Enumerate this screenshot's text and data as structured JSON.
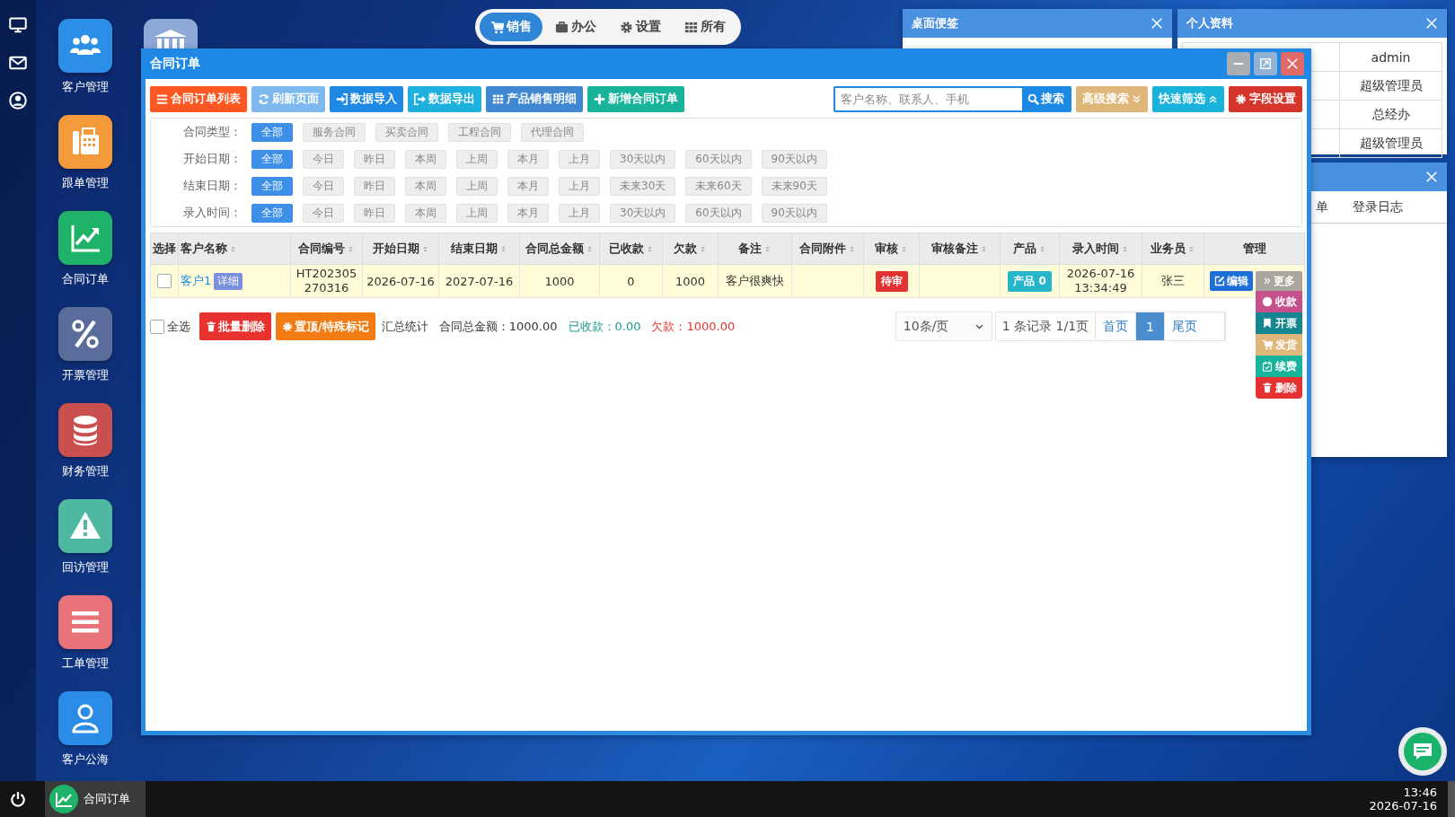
{
  "top_menu": [
    {
      "label": "销售",
      "selected": true
    },
    {
      "label": "办公",
      "selected": false
    },
    {
      "label": "设置",
      "selected": false
    },
    {
      "label": "所有",
      "selected": false
    }
  ],
  "desktop_icons": [
    {
      "label": "客户管理",
      "color": "#2b8fe8"
    },
    {
      "label": "跟单管理",
      "color": "#f39a3a"
    },
    {
      "label": "合同订单",
      "color": "#1fb36a"
    },
    {
      "label": "开票管理",
      "color": "#5a6d9a"
    },
    {
      "label": "财务管理",
      "color": "#c9504f"
    },
    {
      "label": "回访管理",
      "color": "#4fb8a0"
    },
    {
      "label": "工单管理",
      "color": "#e8737a"
    },
    {
      "label": "客户公海",
      "color": "#2a8ce6"
    }
  ],
  "partial_icon": {
    "color": "#8ea8d8"
  },
  "notes_window": {
    "title": "桌面便签"
  },
  "profile_window": {
    "title": "个人资料",
    "values": [
      "admin",
      "超级管理员",
      "总经办",
      "超级管理员"
    ]
  },
  "log_window": {
    "tabs": [
      "单",
      "登录日志"
    ]
  },
  "main_window": {
    "title": "合同订单",
    "toolbar": [
      {
        "label": "合同订单列表",
        "color": "#ff5722"
      },
      {
        "label": "刷新页面",
        "color": "#7db9ee"
      },
      {
        "label": "数据导入",
        "color": "#1e88e5"
      },
      {
        "label": "数据导出",
        "color": "#1eb1df"
      },
      {
        "label": "产品销售明细",
        "color": "#3f88d1"
      },
      {
        "label": "新增合同订单",
        "color": "#17b39a"
      }
    ],
    "search": {
      "placeholder": "客户名称、联系人、手机",
      "button": "搜索"
    },
    "search_tools": [
      {
        "label": "高级搜索",
        "color": "#e0b77b"
      },
      {
        "label": "快速筛选",
        "color": "#19b2da"
      },
      {
        "label": "字段设置",
        "color": "#d6352b"
      }
    ],
    "filters": [
      {
        "label": "合同类型：",
        "options": [
          {
            "label": "全部",
            "selected": true
          },
          {
            "label": "服务合同",
            "selected": false
          },
          {
            "label": "买卖合同",
            "selected": false
          },
          {
            "label": "工程合同",
            "selected": false
          },
          {
            "label": "代理合同",
            "selected": false
          }
        ]
      },
      {
        "label": "开始日期：",
        "options": [
          {
            "label": "全部",
            "selected": true
          },
          {
            "label": "今日",
            "selected": false
          },
          {
            "label": "昨日",
            "selected": false
          },
          {
            "label": "本周",
            "selected": false
          },
          {
            "label": "上周",
            "selected": false
          },
          {
            "label": "本月",
            "selected": false
          },
          {
            "label": "上月",
            "selected": false
          },
          {
            "label": "30天以内",
            "selected": false
          },
          {
            "label": "60天以内",
            "selected": false
          },
          {
            "label": "90天以内",
            "selected": false
          }
        ]
      },
      {
        "label": "结束日期：",
        "options": [
          {
            "label": "全部",
            "selected": true
          },
          {
            "label": "今日",
            "selected": false
          },
          {
            "label": "昨日",
            "selected": false
          },
          {
            "label": "本周",
            "selected": false
          },
          {
            "label": "上周",
            "selected": false
          },
          {
            "label": "本月",
            "selected": false
          },
          {
            "label": "上月",
            "selected": false
          },
          {
            "label": "未来30天",
            "selected": false
          },
          {
            "label": "未来60天",
            "selected": false
          },
          {
            "label": "未来90天",
            "selected": false
          }
        ]
      },
      {
        "label": "录入时间：",
        "options": [
          {
            "label": "全部",
            "selected": true
          },
          {
            "label": "今日",
            "selected": false
          },
          {
            "label": "昨日",
            "selected": false
          },
          {
            "label": "本周",
            "selected": false
          },
          {
            "label": "上周",
            "selected": false
          },
          {
            "label": "本月",
            "selected": false
          },
          {
            "label": "上月",
            "selected": false
          },
          {
            "label": "30天以内",
            "selected": false
          },
          {
            "label": "60天以内",
            "selected": false
          },
          {
            "label": "90天以内",
            "selected": false
          }
        ]
      }
    ],
    "table": {
      "columns": [
        {
          "label": "选择",
          "sortable": false
        },
        {
          "label": "客户名称",
          "sortable": true
        },
        {
          "label": "合同编号",
          "sortable": true
        },
        {
          "label": "开始日期",
          "sortable": true
        },
        {
          "label": "结束日期",
          "sortable": true
        },
        {
          "label": "合同总金额",
          "sortable": true
        },
        {
          "label": "已收款",
          "sortable": true
        },
        {
          "label": "欠款",
          "sortable": true
        },
        {
          "label": "备注",
          "sortable": true
        },
        {
          "label": "合同附件",
          "sortable": true
        },
        {
          "label": "审核",
          "sortable": true
        },
        {
          "label": "审核备注",
          "sortable": true
        },
        {
          "label": "产品",
          "sortable": true
        },
        {
          "label": "录入时间",
          "sortable": true
        },
        {
          "label": "业务员",
          "sortable": true
        },
        {
          "label": "管理",
          "sortable": false
        }
      ],
      "rows": [
        {
          "checked": false,
          "customer": "客户1",
          "detail": "详细",
          "contract_no": "HT202305270316",
          "start_date": "2026-07-16",
          "end_date": "2027-07-16",
          "total": "1000",
          "received": "0",
          "owed": "1000",
          "note": "客户很爽快",
          "review": "待审",
          "product": "产品 0",
          "entered": "2026-07-16 13:34:49",
          "salesperson": "张三",
          "edit": "编辑",
          "more": "更多"
        }
      ]
    },
    "footer": {
      "select_all": {
        "label": "全选",
        "checked": false
      },
      "buttons": [
        {
          "label": "批量删除",
          "color": "#e8322f"
        },
        {
          "label": "置顶/特殊标记",
          "color": "#f27c13"
        }
      ],
      "summary_label": "汇总统计",
      "totals": [
        {
          "text": "合同总金额：1000.00",
          "color": "#333333"
        },
        {
          "text": "已收款：0.00",
          "color": "#1a9a8a"
        },
        {
          "text": "欠款：1000.00",
          "color": "#e8322f"
        }
      ]
    },
    "pagination": {
      "page_size": "10条/页",
      "info": "1 条记录 1/1页",
      "links": [
        {
          "label": "首页",
          "selected": false
        },
        {
          "label": "1",
          "selected": true
        },
        {
          "label": "尾页",
          "selected": false
        }
      ]
    },
    "more_menu": [
      {
        "label": "收款",
        "color": "#c5518c"
      },
      {
        "label": "开票",
        "color": "#15868f"
      },
      {
        "label": "发货",
        "color": "#e0b77b"
      },
      {
        "label": "续费",
        "color": "#17b39a"
      },
      {
        "label": "删除",
        "color": "#e43232"
      }
    ]
  },
  "taskbar": {
    "items": [
      {
        "label": "合同订单"
      }
    ],
    "time": "13:46",
    "date": "2026-07-16"
  }
}
